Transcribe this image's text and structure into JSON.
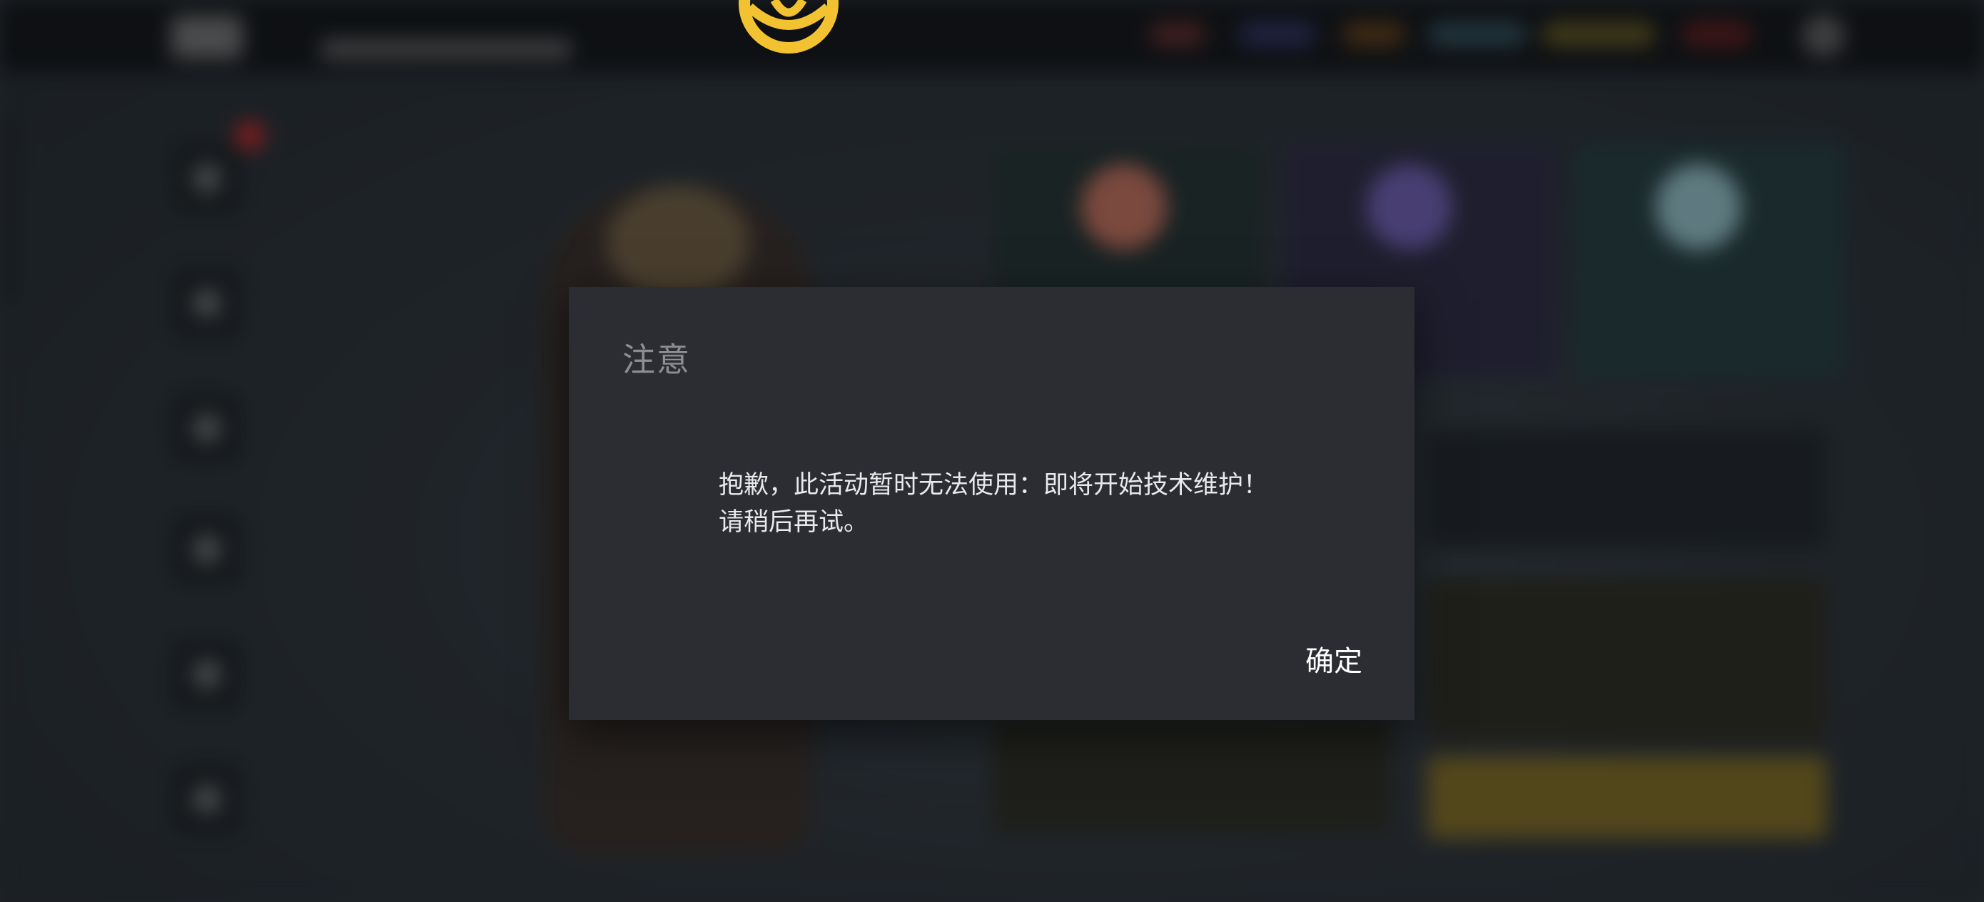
{
  "dialog": {
    "title": "注意",
    "message_line1": "抱歉，此活动暂时无法使用：即将开始技术维护！",
    "message_line2": "请稍后再试。",
    "confirm_label": "确定"
  },
  "colors": {
    "brand_gold": "#f2c230",
    "dialog_bg": "#2c2d32",
    "title_gray": "#8d8e93",
    "message_text": "#e9e9ec"
  },
  "icons": {
    "brand": "gold-circle-logo-icon"
  }
}
